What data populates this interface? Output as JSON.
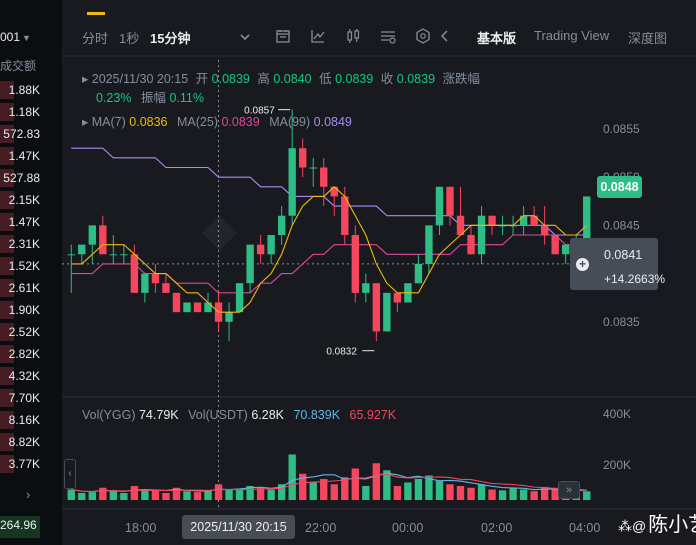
{
  "left_panel": {
    "header_value": "001",
    "column_title": "成交额",
    "rows": [
      {
        "value": "1.88K",
        "side": "red"
      },
      {
        "value": "1.18K",
        "side": "red"
      },
      {
        "value": "572.83",
        "side": "red"
      },
      {
        "value": "1.47K",
        "side": "red"
      },
      {
        "value": "527.88",
        "side": "red"
      },
      {
        "value": "2.15K",
        "side": "red"
      },
      {
        "value": "1.47K",
        "side": "red"
      },
      {
        "value": "2.31K",
        "side": "red"
      },
      {
        "value": "1.52K",
        "side": "red"
      },
      {
        "value": "2.61K",
        "side": "red"
      },
      {
        "value": "1.90K",
        "side": "red"
      },
      {
        "value": "2.52K",
        "side": "red"
      },
      {
        "value": "2.82K",
        "side": "red"
      },
      {
        "value": "4.32K",
        "side": "red"
      },
      {
        "value": "7.70K",
        "side": "red"
      },
      {
        "value": "8.16K",
        "side": "red"
      },
      {
        "value": "8.82K",
        "side": "red"
      },
      {
        "value": "3.77K",
        "side": "red"
      }
    ],
    "bottom_value": "264.96"
  },
  "toolbar": {
    "intervals": [
      "分时",
      "1秒",
      "15分钟"
    ],
    "active_interval": "15分钟",
    "icons": [
      "chevron-down-icon",
      "indicator-icon",
      "draw-line-icon",
      "candle-type-icon",
      "settings-icon",
      "hexagon-settings-icon",
      "chevron-left-icon"
    ],
    "views": [
      "基本版",
      "Trading View",
      "深度图"
    ],
    "active_view": "基本版"
  },
  "ohlc": {
    "datetime": "2025/11/30 20:15",
    "open_label": "开",
    "open": "0.0839",
    "high_label": "高",
    "high": "0.0840",
    "low_label": "低",
    "low": "0.0839",
    "close_label": "收",
    "close": "0.0839",
    "change_label": "涨跌幅",
    "change": "0.23%",
    "amplitude_label": "振幅",
    "amplitude": "0.11%"
  },
  "ma": {
    "ma7_label": "MA(7)",
    "ma7": "0.0836",
    "ma25_label": "MA(25)",
    "ma25": "0.0839",
    "ma99_label": "MA(99)",
    "ma99": "0.0849"
  },
  "volume": {
    "vol_label": "Vol(YGG)",
    "vol_value": "74.79K",
    "vol_usdt_label": "Vol(USDT)",
    "vol_usdt_value": "6.28K",
    "ma_a": "70.839K",
    "ma_b": "65.927K"
  },
  "price_axis": [
    "0.0855",
    "0.0850",
    "0.0845",
    "0.0835"
  ],
  "volume_axis": [
    "400K",
    "200K"
  ],
  "time_axis": [
    "18:00",
    "22:00",
    "00:00",
    "02:00",
    "04:00"
  ],
  "markers": {
    "high": "0.0857",
    "low": "0.0832",
    "last_price": "0.0848",
    "cross_price": "0.0841",
    "cross_pct": "+14.2663%",
    "cross_time": "2025/11/30 20:15"
  },
  "watermark": {
    "text": "陈小艺"
  },
  "colors": {
    "up": "#2ebd85",
    "down": "#f6465d",
    "ma7": "#f0b90b",
    "ma25": "#e0469b",
    "ma99": "#a98bf5",
    "accent": "#f0b90b",
    "volume_ma_a": "#5fb7e5",
    "volume_ma_b": "#f6465d"
  },
  "chart_data": {
    "type": "candlestick",
    "interval": "15m",
    "ylim": [
      0.083,
      0.0858
    ],
    "candles": [
      [
        0.0842,
        0.0843,
        0.0838,
        0.0842
      ],
      [
        0.0842,
        0.0843,
        0.0841,
        0.0843
      ],
      [
        0.0843,
        0.0845,
        0.0841,
        0.0845
      ],
      [
        0.0845,
        0.0846,
        0.0843,
        0.0842
      ],
      [
        0.0842,
        0.0844,
        0.0841,
        0.0842
      ],
      [
        0.0842,
        0.0843,
        0.0841,
        0.0842
      ],
      [
        0.0842,
        0.0843,
        0.0839,
        0.0838
      ],
      [
        0.0838,
        0.084,
        0.0837,
        0.084
      ],
      [
        0.084,
        0.0841,
        0.0838,
        0.0839
      ],
      [
        0.0839,
        0.084,
        0.0838,
        0.0838
      ],
      [
        0.0838,
        0.0838,
        0.0836,
        0.0836
      ],
      [
        0.0836,
        0.0837,
        0.0836,
        0.0837
      ],
      [
        0.0837,
        0.0837,
        0.0836,
        0.0836
      ],
      [
        0.0836,
        0.0838,
        0.0836,
        0.0837
      ],
      [
        0.0837,
        0.0838,
        0.0834,
        0.0835
      ],
      [
        0.0835,
        0.0837,
        0.0833,
        0.0836
      ],
      [
        0.0836,
        0.0839,
        0.0836,
        0.0839
      ],
      [
        0.0839,
        0.0843,
        0.0838,
        0.0843
      ],
      [
        0.0843,
        0.0844,
        0.0841,
        0.0842
      ],
      [
        0.0842,
        0.0844,
        0.0841,
        0.0844
      ],
      [
        0.0844,
        0.0847,
        0.0843,
        0.0846
      ],
      [
        0.0846,
        0.0857,
        0.0845,
        0.0853
      ],
      [
        0.0853,
        0.0854,
        0.085,
        0.0851
      ],
      [
        0.0851,
        0.0852,
        0.0849,
        0.0851
      ],
      [
        0.0851,
        0.0852,
        0.0847,
        0.0849
      ],
      [
        0.0849,
        0.0849,
        0.0846,
        0.0848
      ],
      [
        0.0848,
        0.0849,
        0.0843,
        0.0844
      ],
      [
        0.0844,
        0.0845,
        0.0837,
        0.0838
      ],
      [
        0.0838,
        0.084,
        0.0837,
        0.0839
      ],
      [
        0.0839,
        0.0839,
        0.0833,
        0.0834
      ],
      [
        0.0834,
        0.0838,
        0.0834,
        0.0838
      ],
      [
        0.0838,
        0.0838,
        0.0836,
        0.0837
      ],
      [
        0.0837,
        0.0839,
        0.0837,
        0.0839
      ],
      [
        0.0839,
        0.0842,
        0.0839,
        0.0841
      ],
      [
        0.0841,
        0.0845,
        0.084,
        0.0845
      ],
      [
        0.0845,
        0.0849,
        0.0844,
        0.0849
      ],
      [
        0.0849,
        0.0849,
        0.0845,
        0.0846
      ],
      [
        0.0846,
        0.0849,
        0.0844,
        0.0844
      ],
      [
        0.0844,
        0.0845,
        0.0842,
        0.0842
      ],
      [
        0.0842,
        0.0847,
        0.0841,
        0.0846
      ],
      [
        0.0846,
        0.0846,
        0.0844,
        0.0845
      ],
      [
        0.0845,
        0.0846,
        0.0844,
        0.0845
      ],
      [
        0.0845,
        0.0846,
        0.0844,
        0.0845
      ],
      [
        0.0845,
        0.0847,
        0.0844,
        0.0846
      ],
      [
        0.0846,
        0.0847,
        0.0845,
        0.0845
      ],
      [
        0.0845,
        0.0847,
        0.0843,
        0.0844
      ],
      [
        0.0844,
        0.0844,
        0.0842,
        0.0842
      ],
      [
        0.0842,
        0.0843,
        0.0841,
        0.0843
      ],
      [
        0.0843,
        0.0844,
        0.0842,
        0.0843
      ],
      [
        0.0843,
        0.0848,
        0.0843,
        0.0848
      ]
    ],
    "volumes": [
      60,
      40,
      45,
      70,
      50,
      40,
      80,
      60,
      55,
      40,
      70,
      50,
      45,
      55,
      90,
      60,
      65,
      80,
      70,
      60,
      90,
      260,
      150,
      100,
      120,
      90,
      130,
      180,
      80,
      210,
      170,
      80,
      100,
      120,
      140,
      110,
      90,
      80,
      70,
      90,
      60,
      55,
      70,
      60,
      50,
      75,
      60,
      50,
      40,
      50
    ],
    "ma7": [
      0.0841,
      0.0841,
      0.0842,
      0.0843,
      0.0843,
      0.0843,
      0.0842,
      0.0841,
      0.084,
      0.084,
      0.0839,
      0.0838,
      0.0838,
      0.0837,
      0.0836,
      0.0836,
      0.0836,
      0.0837,
      0.0839,
      0.084,
      0.0842,
      0.0845,
      0.0847,
      0.0848,
      0.0848,
      0.0849,
      0.0848,
      0.0846,
      0.0844,
      0.0841,
      0.0839,
      0.0838,
      0.0838,
      0.0838,
      0.084,
      0.0842,
      0.0843,
      0.0844,
      0.0845,
      0.0845,
      0.0845,
      0.0845,
      0.0845,
      0.0846,
      0.0846,
      0.0845,
      0.0845,
      0.0844,
      0.0844,
      0.0845
    ],
    "ma25": [
      0.084,
      0.084,
      0.084,
      0.0841,
      0.0841,
      0.0841,
      0.0841,
      0.084,
      0.084,
      0.084,
      0.0839,
      0.0839,
      0.0839,
      0.0839,
      0.0838,
      0.0838,
      0.0838,
      0.0838,
      0.0839,
      0.0839,
      0.084,
      0.084,
      0.0841,
      0.0842,
      0.0842,
      0.0843,
      0.0843,
      0.0843,
      0.0843,
      0.0843,
      0.0842,
      0.0842,
      0.0842,
      0.0842,
      0.0842,
      0.0842,
      0.0842,
      0.0843,
      0.0843,
      0.0843,
      0.0843,
      0.0843,
      0.0844,
      0.0844,
      0.0844,
      0.0844,
      0.0844,
      0.0843,
      0.0843,
      0.0843
    ],
    "ma99": [
      0.0853,
      0.0853,
      0.0853,
      0.0853,
      0.0852,
      0.0852,
      0.0852,
      0.0852,
      0.0852,
      0.0851,
      0.0851,
      0.0851,
      0.0851,
      0.0851,
      0.085,
      0.085,
      0.085,
      0.085,
      0.0849,
      0.0849,
      0.0849,
      0.0848,
      0.0848,
      0.0848,
      0.0848,
      0.0847,
      0.0847,
      0.0847,
      0.0847,
      0.0847,
      0.0846,
      0.0846,
      0.0846,
      0.0846,
      0.0846,
      0.0846,
      0.0846,
      0.0845,
      0.0845,
      0.0845,
      0.0845,
      0.0845,
      0.0845,
      0.0845,
      0.0845,
      0.0845,
      0.0844,
      0.0844,
      0.0844,
      0.0844
    ]
  }
}
